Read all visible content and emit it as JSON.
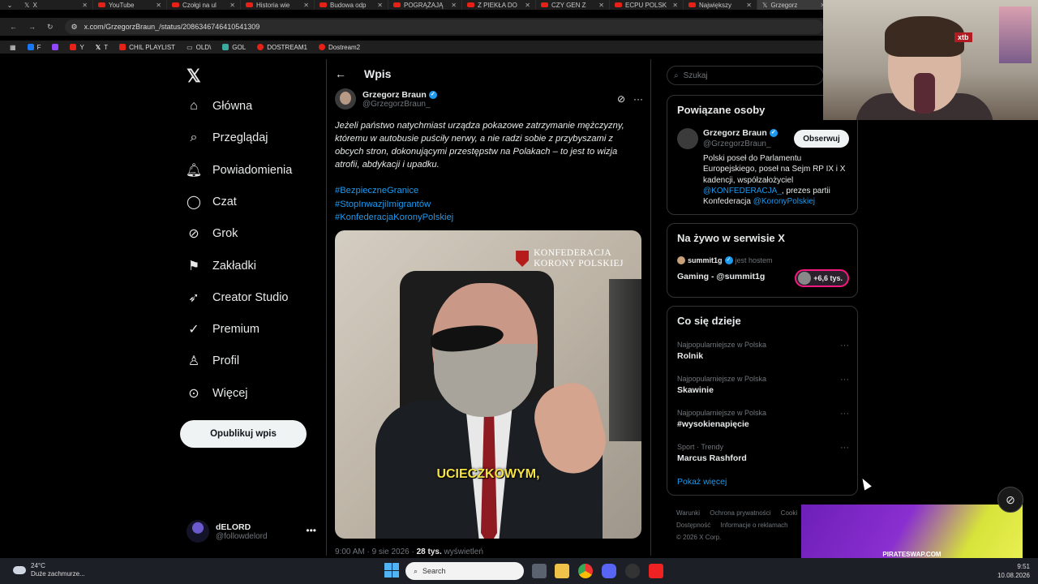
{
  "browser": {
    "tabs": [
      {
        "label": "X",
        "active": false
      },
      {
        "label": "YouTube",
        "active": false
      },
      {
        "label": "Czołgi na ul",
        "active": false
      },
      {
        "label": "Historia wie",
        "active": false
      },
      {
        "label": "Budowa odp",
        "active": false
      },
      {
        "label": "POGRĄŻAJĄ",
        "active": false
      },
      {
        "label": "Z PIEKŁA DO",
        "active": false
      },
      {
        "label": "CZY GEN Z",
        "active": false
      },
      {
        "label": "ECPU POLSK",
        "active": false
      },
      {
        "label": "Największy",
        "active": false
      },
      {
        "label": "Grzegorz",
        "active": true
      }
    ],
    "url": "x.com/GrzegorzBraun_/status/2086346746410541309",
    "bookmarks": [
      "F",
      "Y",
      "T",
      "CHIL PLAYLIST",
      "OLD\\",
      "GOL",
      "DOSTREAM1",
      "Dostream2"
    ]
  },
  "nav": {
    "items": [
      {
        "label": "Główna",
        "icon": "home-icon"
      },
      {
        "label": "Przeglądaj",
        "icon": "search-icon"
      },
      {
        "label": "Powiadomienia",
        "icon": "bell-icon"
      },
      {
        "label": "Czat",
        "icon": "chat-icon"
      },
      {
        "label": "Grok",
        "icon": "grok-icon"
      },
      {
        "label": "Zakładki",
        "icon": "bookmark-icon"
      },
      {
        "label": "Creator Studio",
        "icon": "rocket-icon"
      },
      {
        "label": "Premium",
        "icon": "verified-icon"
      },
      {
        "label": "Profil",
        "icon": "person-icon"
      },
      {
        "label": "Więcej",
        "icon": "more-circle-icon"
      }
    ],
    "post_button": "Opublikuj wpis",
    "account": {
      "name": "dELORD",
      "handle": "@followdelord"
    }
  },
  "post": {
    "header": "Wpis",
    "author_name": "Grzegorz Braun",
    "author_handle": "@GrzegorzBraun_",
    "text": "Jeżeli państwo natychmiast urządza pokazowe zatrzymanie mężczyzny, któremu w autobusie puściły nerwy, a nie radzi sobie z przybyszami z obcych stron, dokonującymi przestępstw na Polakach – to jest to wizja atrofii, abdykacji i upadku.",
    "hashtags": [
      "#BezpieczneGranice",
      "#StopInwazjiImigrantów",
      "#KonfederacjaKoronyPolskiej"
    ],
    "media_logo_line1": "KONFEDERACJA",
    "media_logo_line2": "KORONY POLSKIEJ",
    "media_caption": "UCIECZKOWYM,",
    "time": "9:00 AM · 9 sie 2026 ·",
    "views": "28 tys.",
    "views_label": "wyświetleń"
  },
  "sidebar": {
    "search_placeholder": "Szukaj",
    "related": {
      "title": "Powiązane osoby",
      "name": "Grzegorz Braun",
      "handle": "@GrzegorzBraun_",
      "follow": "Obserwuj",
      "bio_1": "Polski poseł do Parlamentu Europejskiego, poseł na Sejm RP IX i X kadencji, współzałożyciel",
      "bio_link1": "@KONFEDERACJA_",
      "bio_2": ", prezes partii Konfederacja",
      "bio_link2": "@KoronyPolskiej"
    },
    "live": {
      "title": "Na żywo w serwisie X",
      "host": "summit1g",
      "host_suffix": "jest hostem",
      "event": "Gaming - @summit1g",
      "count": "+6,6 tys."
    },
    "trends": {
      "title": "Co się dzieje",
      "items": [
        {
          "context": "Najpopularniejsze w Polska",
          "topic": "Rolnik"
        },
        {
          "context": "Najpopularniejsze w Polska",
          "topic": "Skawinie"
        },
        {
          "context": "Najpopularniejsze w Polska",
          "topic": "#wysokienapięcie"
        },
        {
          "context": "Sport · Trendy",
          "topic": "Marcus Rashford"
        }
      ],
      "show_more": "Pokaż więcej"
    },
    "footer": [
      "Warunki",
      "Ochrona prywatności",
      "Cooki",
      "Dostępność",
      "Informacje o reklamach",
      "© 2026 X Corp."
    ]
  },
  "overlay": {
    "webcam_badge": "xtb",
    "stream_label": "PIRATESWAP.COM"
  },
  "taskbar": {
    "temp": "24°C",
    "weather": "Duże zachmurze...",
    "search": "Search",
    "time": "9:51",
    "date": "10.08.2026"
  }
}
